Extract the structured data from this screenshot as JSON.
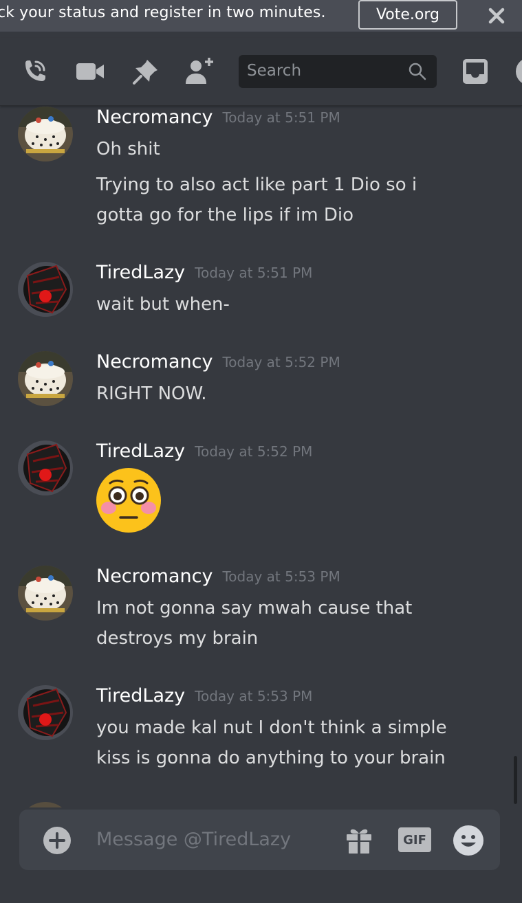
{
  "notice": {
    "text": "ck your status and register in two minutes.",
    "button_label": "Vote.org",
    "close_icon": "close-icon"
  },
  "toolbar": {
    "icons": [
      "call-icon",
      "video-call-icon",
      "pin-icon",
      "add-friend-icon",
      "inbox-icon"
    ],
    "search_placeholder": "Search"
  },
  "messages": [
    {
      "author": "Necromancy",
      "timestamp": "Today at 5:51 PM",
      "lines": [
        "Oh shit",
        "Trying to also act like part 1 Dio so i",
        "gotta go for the lips if im Dio"
      ]
    },
    {
      "author": "TiredLazy",
      "timestamp": "Today at 5:51 PM",
      "lines": [
        "wait but when-"
      ]
    },
    {
      "author": "Necromancy",
      "timestamp": "Today at 5:52 PM",
      "lines": [
        "RIGHT NOW."
      ]
    },
    {
      "author": "TiredLazy",
      "timestamp": "Today at 5:52 PM",
      "emoji": "flushed-face-emoji"
    },
    {
      "author": "Necromancy",
      "timestamp": "Today at 5:53 PM",
      "lines": [
        "Im not gonna say mwah cause that",
        "destroys my brain"
      ]
    },
    {
      "author": "TiredLazy",
      "timestamp": "Today at 5:53 PM",
      "lines": [
        "you made kal nut I don't think a simple",
        "kiss is gonna do anything to your brain"
      ]
    }
  ],
  "composer": {
    "placeholder": "Message @TiredLazy",
    "gif_label": "GIF"
  },
  "colors": {
    "background": "#36393f",
    "notice_bar": "#4a4d55",
    "search_bg": "#202225",
    "composer_bg": "#40444b",
    "username": "#ffffff",
    "timestamp": "#72767d",
    "message_text": "#dcddde",
    "icon": "#b9bbbe"
  }
}
